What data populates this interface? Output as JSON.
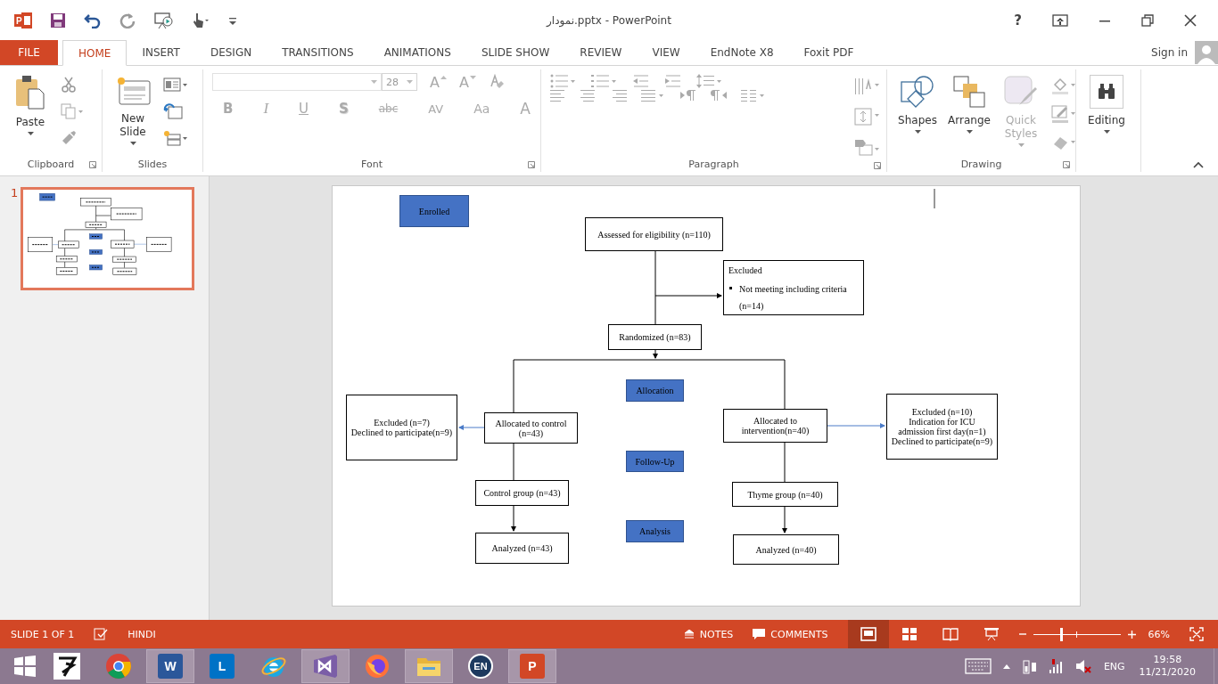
{
  "title_bar": {
    "title": "نمودار.pptx - PowerPoint",
    "app_glyph": "P",
    "help": "?",
    "sign_in": "Sign in"
  },
  "tabs": [
    {
      "label": "FILE",
      "kind": "file",
      "selected": false
    },
    {
      "label": "HOME",
      "kind": "tab",
      "selected": true
    },
    {
      "label": "INSERT",
      "kind": "tab",
      "selected": false
    },
    {
      "label": "DESIGN",
      "kind": "tab",
      "selected": false
    },
    {
      "label": "TRANSITIONS",
      "kind": "tab",
      "selected": false
    },
    {
      "label": "ANIMATIONS",
      "kind": "tab",
      "selected": false
    },
    {
      "label": "SLIDE SHOW",
      "kind": "tab",
      "selected": false
    },
    {
      "label": "REVIEW",
      "kind": "tab",
      "selected": false
    },
    {
      "label": "VIEW",
      "kind": "tab",
      "selected": false
    },
    {
      "label": "EndNote X8",
      "kind": "tab",
      "selected": false
    },
    {
      "label": "Foxit PDF",
      "kind": "tab",
      "selected": false
    }
  ],
  "ribbon": {
    "clipboard": {
      "label": "Clipboard",
      "paste": "Paste"
    },
    "slides": {
      "label": "Slides",
      "new_slide": "New Slide"
    },
    "font": {
      "label": "Font",
      "disabled": true,
      "size": "28",
      "grow": "A",
      "shrink": "A",
      "buttons": [
        "B",
        "I",
        "U",
        "S",
        "abc",
        "AV",
        "Aa",
        "A"
      ]
    },
    "paragraph": {
      "label": "Paragraph",
      "disabled": true
    },
    "drawing": {
      "label": "Drawing",
      "shapes": "Shapes",
      "arrange": "Arrange",
      "quick_styles": {
        "label": "Quick Styles",
        "disabled": true
      }
    },
    "editing": {
      "label": "Editing"
    }
  },
  "thumbnails": [
    {
      "number": "1",
      "selected": true
    }
  ],
  "slide": {
    "nodes": [
      {
        "kind": "stage",
        "lines": [
          "Enrolled"
        ]
      },
      {
        "kind": "box",
        "lines": [
          "Assessed for eligibility (n=110)"
        ]
      },
      {
        "kind": "list",
        "title": "Excluded",
        "bullets": [
          "Not meeting including criteria (n=14)"
        ]
      },
      {
        "kind": "box",
        "lines": [
          "Randomized (n=83)"
        ]
      },
      {
        "kind": "stage",
        "lines": [
          "Allocation"
        ]
      },
      {
        "kind": "box",
        "lines": [
          "Excluded (n=7)",
          "Declined to participate(n=9)"
        ]
      },
      {
        "kind": "box",
        "lines": [
          "Allocated to control (n=43)"
        ]
      },
      {
        "kind": "box",
        "lines": [
          "Allocated to intervention(n=40)"
        ]
      },
      {
        "kind": "box",
        "lines": [
          "Excluded (n=10)",
          "Indication for ICU admission first day(n=1)",
          "Declined to participate(n=9)"
        ]
      },
      {
        "kind": "stage",
        "lines": [
          "Follow-Up"
        ]
      },
      {
        "kind": "box",
        "lines": [
          "Control group (n=43)"
        ]
      },
      {
        "kind": "box",
        "lines": [
          "Thyme group (n=40)"
        ]
      },
      {
        "kind": "stage",
        "lines": [
          "Analysis"
        ]
      },
      {
        "kind": "box",
        "lines": [
          "Analyzed (n=43)"
        ]
      },
      {
        "kind": "box",
        "lines": [
          "Analyzed (n=40)"
        ]
      }
    ]
  },
  "status_bar": {
    "slide_info": "SLIDE 1 OF 1",
    "language": "HINDI",
    "notes": "NOTES",
    "comments": "COMMENTS",
    "views": [
      {
        "kind": "normal",
        "selected": true
      },
      {
        "kind": "sorter",
        "selected": false
      },
      {
        "kind": "reading",
        "selected": false
      },
      {
        "kind": "slideshow",
        "selected": false
      }
    ],
    "zoom": {
      "level": 0.32,
      "reading": "66%"
    }
  },
  "taskbar": {
    "apps": [
      {
        "kind": "tool",
        "open": false
      },
      {
        "kind": "chrome",
        "open": false
      },
      {
        "kind": "word",
        "glyph": "W",
        "open": true
      },
      {
        "kind": "lync",
        "glyph": "L",
        "open": false
      },
      {
        "kind": "ie",
        "open": false
      },
      {
        "kind": "vs",
        "open": true
      },
      {
        "kind": "firefox",
        "open": false
      },
      {
        "kind": "explorer",
        "open": true
      },
      {
        "kind": "endnote",
        "glyph": "EN",
        "open": false
      },
      {
        "kind": "powerpoint",
        "glyph": "P",
        "open": true
      }
    ],
    "language": "ENG",
    "time": "19:58",
    "date": "11/21/2020"
  }
}
